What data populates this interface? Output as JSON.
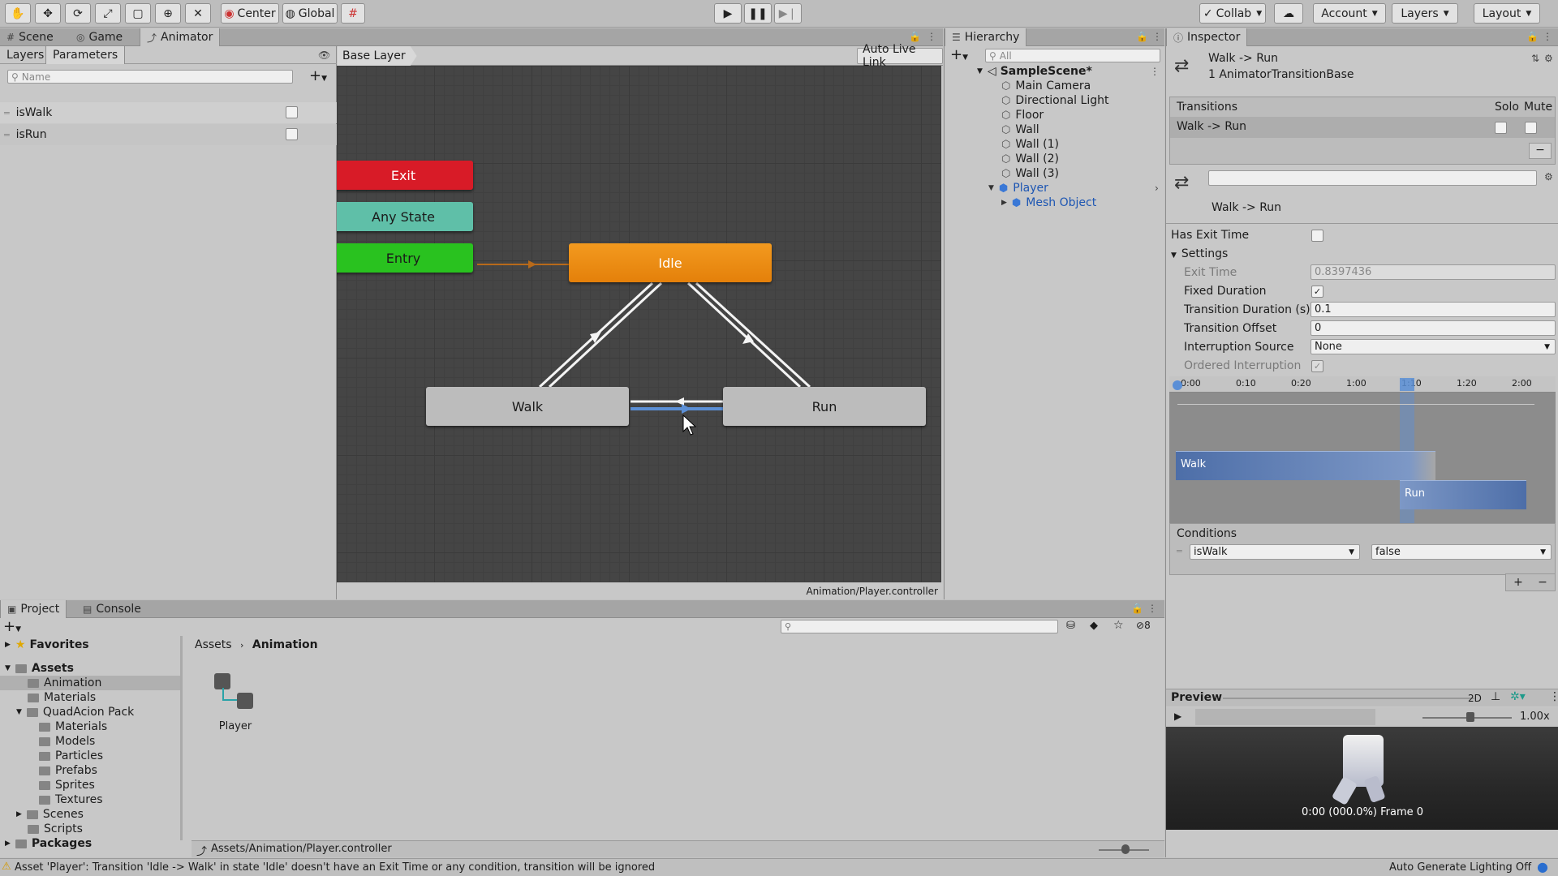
{
  "toolbar": {
    "tools": [
      "hand-tool",
      "move-tool",
      "rotate-tool",
      "scale-tool",
      "rect-tool",
      "transform-tool",
      "custom-tool"
    ],
    "pivot_label": "Center",
    "space_label": "Global",
    "collab_label": "Collab",
    "account_label": "Account",
    "layers_label": "Layers",
    "layout_label": "Layout"
  },
  "animator_window": {
    "tabs": [
      {
        "label": "Scene"
      },
      {
        "label": "Game"
      },
      {
        "label": "Animator"
      }
    ],
    "sub_tabs": {
      "layers": "Layers",
      "parameters": "Parameters"
    },
    "search_placeholder": "Name",
    "parameters": [
      {
        "name": "isWalk",
        "value": false
      },
      {
        "name": "isRun",
        "value": false
      }
    ],
    "breadcrumb": "Base Layer",
    "auto_live_link": "Auto Live Link",
    "states": {
      "exit": "Exit",
      "any_state": "Any State",
      "entry": "Entry",
      "idle": "Idle",
      "walk": "Walk",
      "run": "Run"
    },
    "footer_path": "Animation/Player.controller"
  },
  "hierarchy": {
    "title": "Hierarchy",
    "search_placeholder": "All",
    "scene_name": "SampleScene*",
    "items": [
      {
        "label": "Main Camera",
        "indent": 1
      },
      {
        "label": "Directional Light",
        "indent": 1
      },
      {
        "label": "Floor",
        "indent": 1
      },
      {
        "label": "Wall",
        "indent": 1
      },
      {
        "label": "Wall (1)",
        "indent": 1
      },
      {
        "label": "Wall (2)",
        "indent": 1
      },
      {
        "label": "Wall (3)",
        "indent": 1
      },
      {
        "label": "Player",
        "indent": 1
      },
      {
        "label": "Mesh Object",
        "indent": 2
      }
    ]
  },
  "inspector": {
    "title": "Inspector",
    "header_title": "Walk -> Run",
    "header_subtitle": "1 AnimatorTransitionBase",
    "transitions_label": "Transitions",
    "solo_label": "Solo",
    "mute_label": "Mute",
    "transition_row": "Walk -> Run",
    "transition_name": "Walk -> Run",
    "has_exit_time_label": "Has Exit Time",
    "has_exit_time": false,
    "settings_label": "Settings",
    "exit_time_label": "Exit Time",
    "exit_time_value": "0.8397436",
    "fixed_duration_label": "Fixed Duration",
    "fixed_duration": true,
    "transition_duration_label": "Transition Duration (s)",
    "transition_duration_value": "0.1",
    "transition_offset_label": "Transition Offset",
    "transition_offset_value": "0",
    "interruption_source_label": "Interruption Source",
    "interruption_source_value": "None",
    "ordered_interruption_label": "Ordered Interruption",
    "ordered_interruption": true,
    "timeline_ticks": [
      "0:00",
      "0:10",
      "0:20",
      "1:00",
      "1:10",
      "1:20",
      "2:00"
    ],
    "timeline_walk": "Walk",
    "timeline_run": "Run",
    "conditions_label": "Conditions",
    "condition_param": "isWalk",
    "condition_value": "false",
    "preview_label": "Preview",
    "preview_2d": "2D",
    "preview_speed": "1.00x",
    "preview_time": "0:00 (000.0%) Frame 0"
  },
  "project": {
    "tabs": [
      {
        "label": "Project"
      },
      {
        "label": "Console"
      }
    ],
    "hidden_count": "8",
    "favorites": "Favorites",
    "tree": [
      {
        "label": "Assets",
        "indent": 0,
        "bold": true
      },
      {
        "label": "Animation",
        "indent": 1,
        "selected": true
      },
      {
        "label": "Materials",
        "indent": 1
      },
      {
        "label": "QuadAcion Pack",
        "indent": 1
      },
      {
        "label": "Materials",
        "indent": 2
      },
      {
        "label": "Models",
        "indent": 2
      },
      {
        "label": "Particles",
        "indent": 2
      },
      {
        "label": "Prefabs",
        "indent": 2
      },
      {
        "label": "Sprites",
        "indent": 2
      },
      {
        "label": "Textures",
        "indent": 2
      },
      {
        "label": "Scenes",
        "indent": 1
      },
      {
        "label": "Scripts",
        "indent": 1
      },
      {
        "label": "Packages",
        "indent": 0,
        "bold": true
      }
    ],
    "breadcrumb_root": "Assets",
    "breadcrumb_current": "Animation",
    "asset_name": "Player",
    "footer_path": "Assets/Animation/Player.controller"
  },
  "status_bar": {
    "message": "Asset 'Player': Transition 'Idle -> Walk' in state 'Idle' doesn't have an Exit Time or any condition, transition will be ignored",
    "lighting": "Auto Generate Lighting Off"
  },
  "colors": {
    "exit": "#d81b27",
    "any_state": "#5fbfa8",
    "entry": "#29c21f",
    "idle": "#f08c12",
    "selection_blue": "#5b8fd6"
  }
}
